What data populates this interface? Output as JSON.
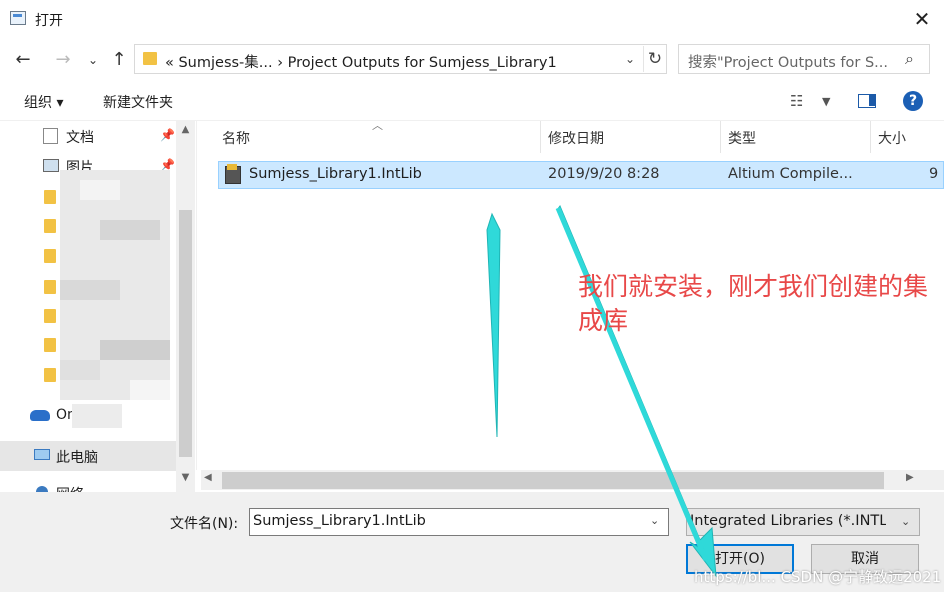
{
  "window": {
    "title": "打开",
    "close_symbol": "✕"
  },
  "address": {
    "path": "«  Sumjess-集...  ›  Project Outputs for Sumjess_Library1",
    "search_placeholder": "搜索\"Project Outputs for S..."
  },
  "toolbar": {
    "organize": "组织 ▾",
    "new_folder": "新建文件夹",
    "help": "?"
  },
  "nav_pane": {
    "items": [
      {
        "label": "文档"
      },
      {
        "label": "图片"
      },
      {
        "label": "OneDrive"
      },
      {
        "label": "此电脑"
      },
      {
        "label": "网络"
      }
    ]
  },
  "file_list": {
    "columns": [
      "名称",
      "修改日期",
      "类型",
      "大小"
    ],
    "rows": [
      {
        "name": "Sumjess_Library1.IntLib",
        "modified": "2019/9/20 8:28",
        "type": "Altium Compile...",
        "size": "9"
      }
    ]
  },
  "bottom": {
    "filename_label": "文件名(N):",
    "filename_value": "Sumjess_Library1.IntLib",
    "filter_value": "Integrated Libraries (*.INTLIB",
    "open_button": "打开(O)",
    "cancel_button": "取消"
  },
  "annotation": {
    "text": "我们就安装，刚才我们创建的集成库",
    "color": "#e84848",
    "arrow_color": "#2fd9d9"
  },
  "watermark": "https://bl... CSDN @宁静致远2021"
}
